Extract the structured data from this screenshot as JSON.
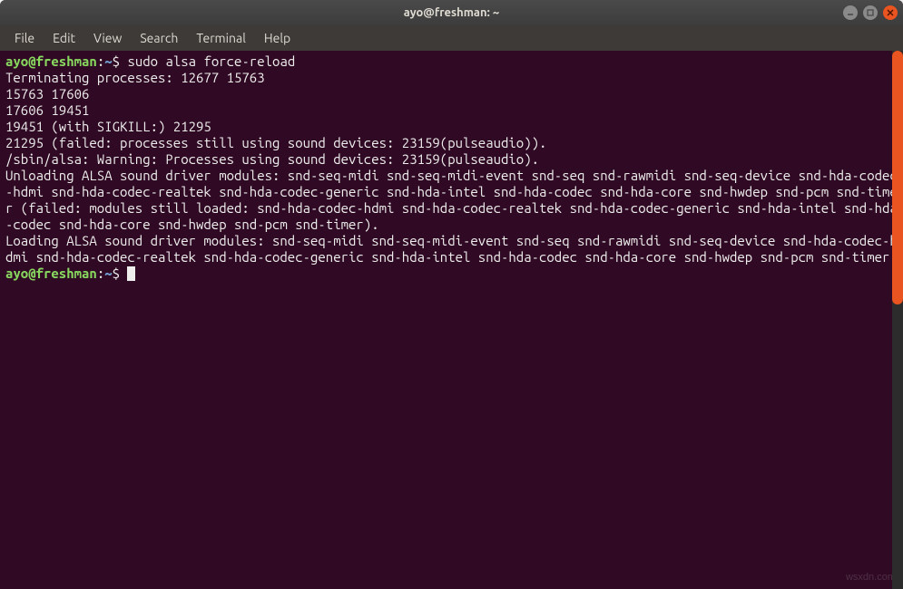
{
  "window": {
    "title": "ayo@freshman: ~"
  },
  "menu": {
    "file": "File",
    "edit": "Edit",
    "view": "View",
    "search": "Search",
    "terminal": "Terminal",
    "help": "Help"
  },
  "prompt": {
    "user_host": "ayo@freshman",
    "colon": ":",
    "path": "~",
    "symbol": "$"
  },
  "command": "sudo alsa force-reload",
  "output_lines": [
    "Terminating processes: 12677 15763",
    "15763 17606",
    "17606 19451",
    "19451 (with SIGKILL:) 21295",
    "21295 (failed: processes still using sound devices: 23159(pulseaudio)).",
    "/sbin/alsa: Warning: Processes using sound devices: 23159(pulseaudio).",
    "Unloading ALSA sound driver modules: snd-seq-midi snd-seq-midi-event snd-seq snd-rawmidi snd-seq-device snd-hda-codec-hdmi snd-hda-codec-realtek snd-hda-codec-generic snd-hda-intel snd-hda-codec snd-hda-core snd-hwdep snd-pcm snd-timer (failed: modules still loaded: snd-hda-codec-hdmi snd-hda-codec-realtek snd-hda-codec-generic snd-hda-intel snd-hda-codec snd-hda-core snd-hwdep snd-pcm snd-timer).",
    "Loading ALSA sound driver modules: snd-seq-midi snd-seq-midi-event snd-seq snd-rawmidi snd-seq-device snd-hda-codec-hdmi snd-hda-codec-realtek snd-hda-codec-generic snd-hda-intel snd-hda-codec snd-hda-core snd-hwdep snd-pcm snd-timer."
  ],
  "watermark": "wsxdn.com"
}
